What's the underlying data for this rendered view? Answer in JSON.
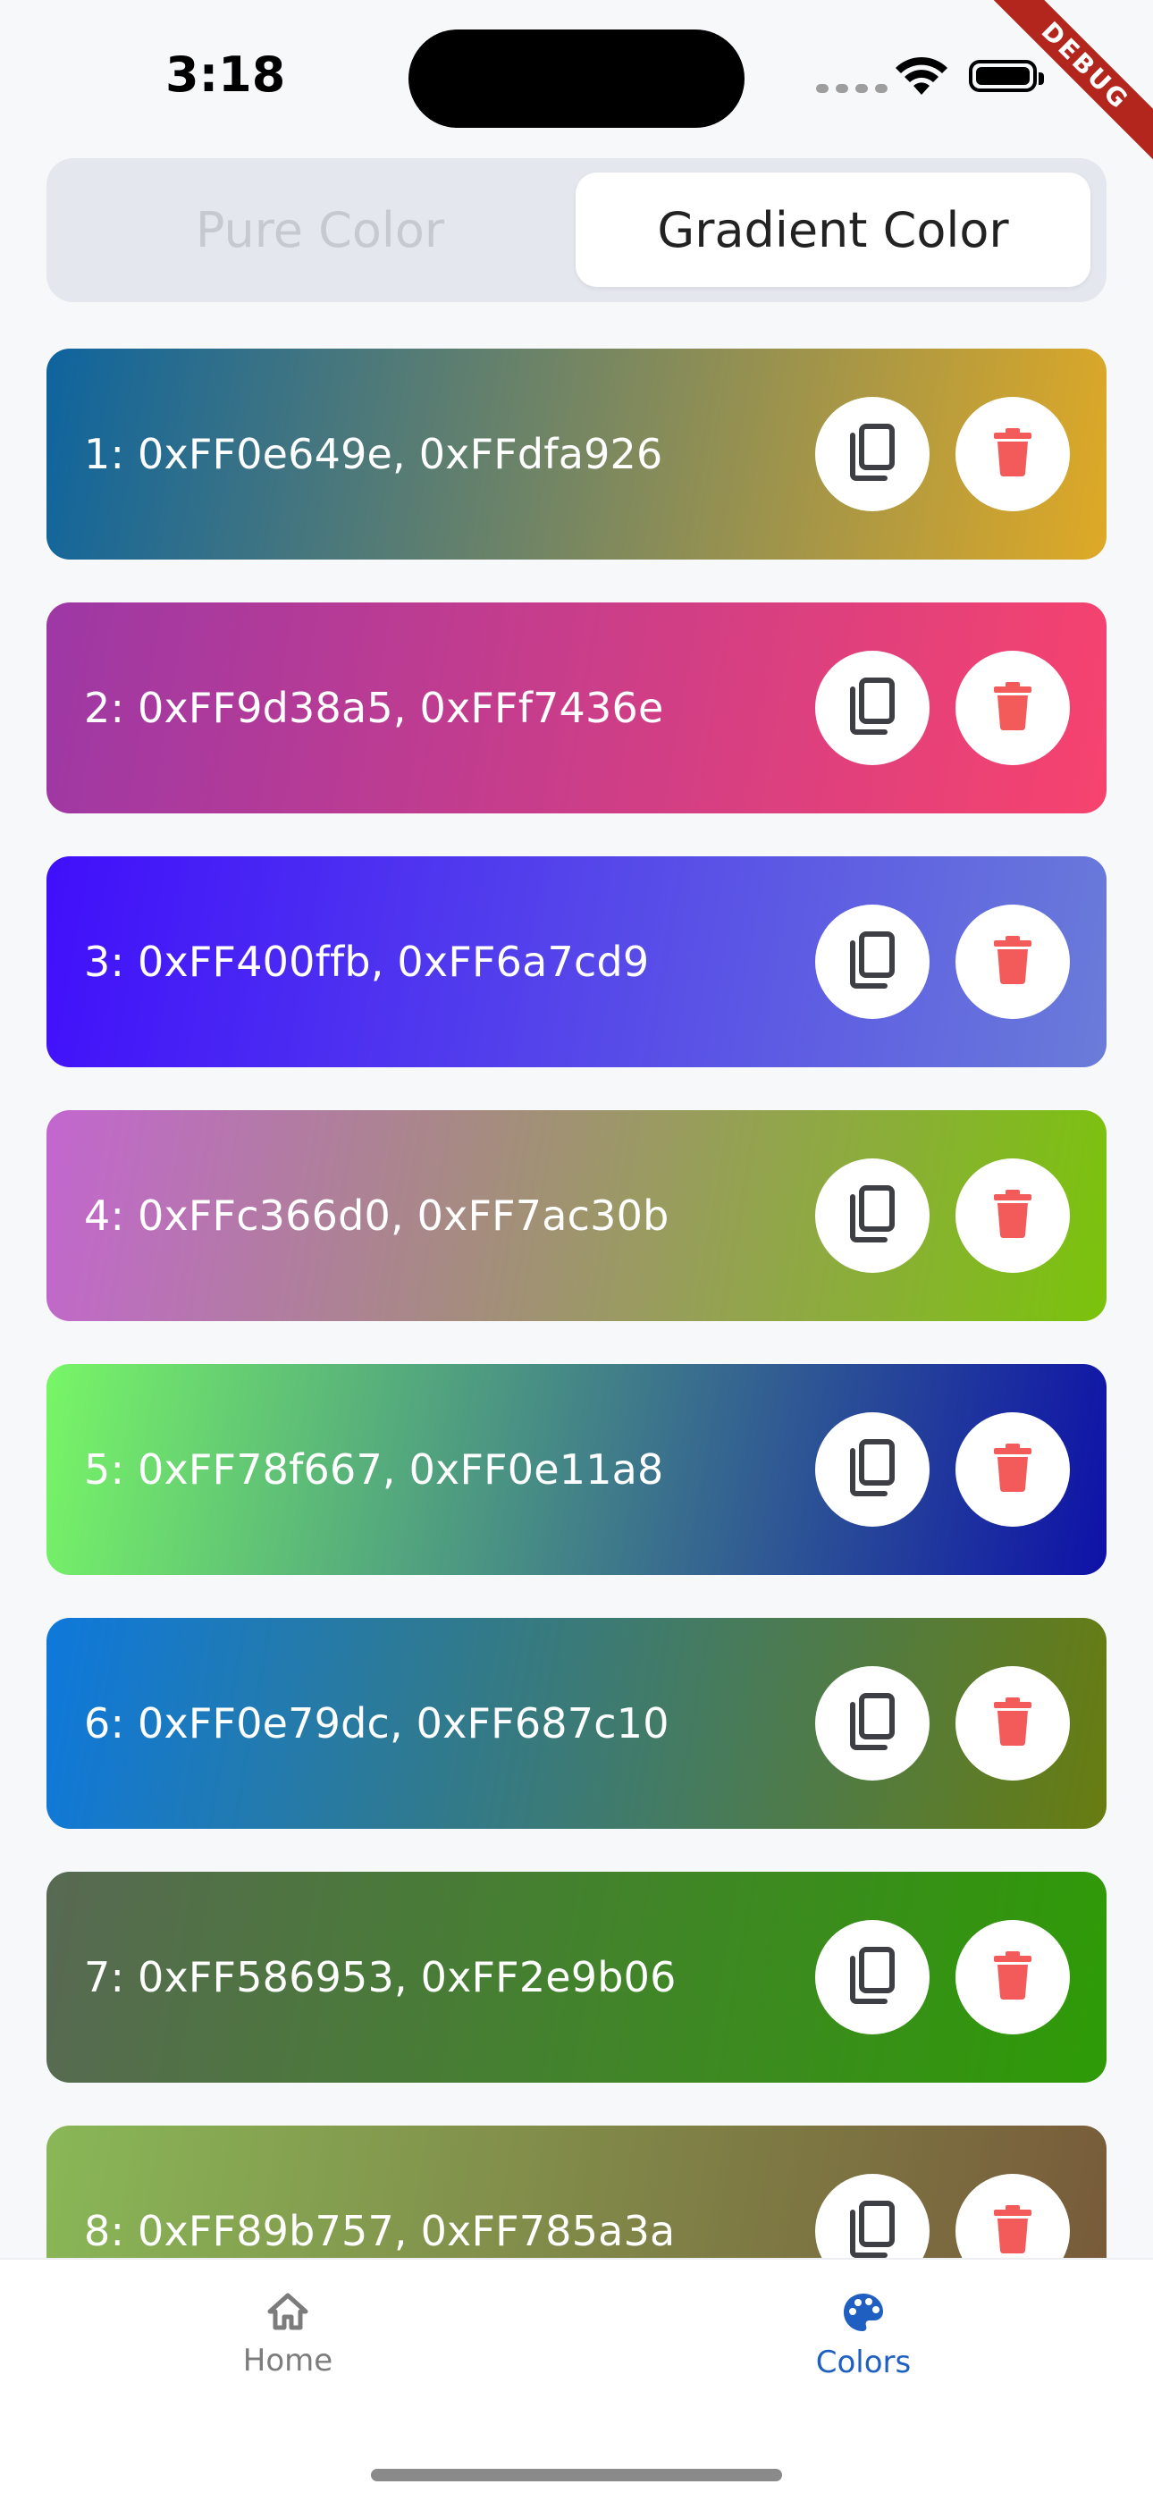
{
  "status_bar": {
    "time": "3:18",
    "debug_banner": "DEBUG"
  },
  "segmented": {
    "options": [
      "Pure Color",
      "Gradient Color"
    ],
    "selected": "Gradient Color"
  },
  "gradients": [
    {
      "label": "1: 0xFF0e649e, 0xFFdfa926",
      "start": "#0e649e",
      "end": "#dfa926"
    },
    {
      "label": "2: 0xFF9d38a5, 0xFFf7436e",
      "start": "#9d38a5",
      "end": "#f7436e"
    },
    {
      "label": "3: 0xFF400ffb, 0xFF6a7cd9",
      "start": "#400ffb",
      "end": "#6a7cd9"
    },
    {
      "label": "4: 0xFFc366d0, 0xFF7ac30b",
      "start": "#c366d0",
      "end": "#7ac30b"
    },
    {
      "label": "5: 0xFF78f667, 0xFF0e11a8",
      "start": "#78f667",
      "end": "#0e11a8"
    },
    {
      "label": "6: 0xFF0e79dc, 0xFF687c10",
      "start": "#0e79dc",
      "end": "#687c10"
    },
    {
      "label": "7: 0xFF586953, 0xFF2e9b06",
      "start": "#586953",
      "end": "#2e9b06"
    },
    {
      "label": "8: 0xFF89b757, 0xFF785a3a",
      "start": "#89b757",
      "end": "#785a3a"
    }
  ],
  "actions": {
    "copy_icon": "copy-icon",
    "delete_icon": "trash-icon",
    "delete_color": "#f35b5b",
    "copy_color": "#3d3f44"
  },
  "bottom_nav": {
    "items": [
      {
        "label": "Home",
        "icon": "home-icon"
      },
      {
        "label": "Colors",
        "icon": "palette-icon"
      }
    ],
    "active": "Colors",
    "active_color": "#1f5fc2"
  }
}
